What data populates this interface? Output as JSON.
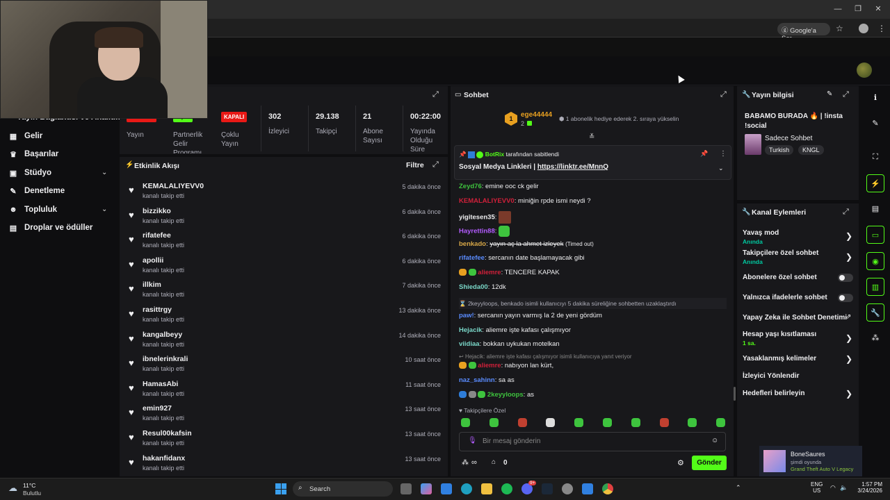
{
  "browser": {
    "google_sor": "Google'a Sor"
  },
  "stats": {
    "live_badge": "YAYINDA",
    "partner_badge": "AÇIK",
    "multi_badge": "KAPALI",
    "live_label": "Yayın",
    "partner_label": "Partnerlik Gelir Programı",
    "multi_label": "Çoklu Yayın",
    "viewers_value": "302",
    "viewers_label": "İzleyici",
    "followers_value": "29.138",
    "followers_label": "Takipçi",
    "subs_value": "21",
    "subs_label": "Abone Sayısı",
    "uptime_value": "00:22:00",
    "uptime_label": "Yayında Olduğu Süre"
  },
  "sidebar": {
    "partial_title": "Yayın Bağlantısı ve Analitik",
    "items": [
      {
        "label": "Gelir",
        "icon": "chart-icon"
      },
      {
        "label": "Başarılar",
        "icon": "trophy-icon"
      },
      {
        "label": "Stüdyo",
        "icon": "studio-icon"
      },
      {
        "label": "Denetleme",
        "icon": "wrench-icon"
      },
      {
        "label": "Topluluk",
        "icon": "community-icon"
      },
      {
        "label": "Droplar ve ödüller",
        "icon": "gift-icon"
      }
    ]
  },
  "activity": {
    "title": "Etkinlik Akışı",
    "filter": "Filtre",
    "events": [
      {
        "name": "KEMALALIYEVV0",
        "sub": "kanalı takip etti",
        "time": "5 dakika önce"
      },
      {
        "name": "bizzikko",
        "sub": "kanalı takip etti",
        "time": "6 dakika önce"
      },
      {
        "name": "rifatefee",
        "sub": "kanalı takip etti",
        "time": "6 dakika önce"
      },
      {
        "name": "apollii",
        "sub": "kanalı takip etti",
        "time": "6 dakika önce"
      },
      {
        "name": "illkim",
        "sub": "kanalı takip etti",
        "time": "7 dakika önce"
      },
      {
        "name": "rasittrgy",
        "sub": "kanalı takip etti",
        "time": "13 dakika önce"
      },
      {
        "name": "kangalbeyy",
        "sub": "kanalı takip etti",
        "time": "14 dakika önce"
      },
      {
        "name": "ibnelerinkrali",
        "sub": "kanalı takip etti",
        "time": "10 saat önce"
      },
      {
        "name": "HamasAbi",
        "sub": "kanalı takip etti",
        "time": "11 saat önce"
      },
      {
        "name": "emin927",
        "sub": "kanalı takip etti",
        "time": "13 saat önce"
      },
      {
        "name": "Resul00kafsin",
        "sub": "kanalı takip etti",
        "time": "13 saat önce"
      },
      {
        "name": "hakanfidanx",
        "sub": "kanalı takip etti",
        "time": "13 saat önce"
      }
    ]
  },
  "chat": {
    "title": "Sohbet",
    "top_gifter": "ege44444",
    "top_gifter_rank": "1",
    "top_gifter_count": "2",
    "gift_text": "1 abonelik hediye ederek 2. sıraya yükselin",
    "pin_author": "BotRix",
    "pin_by": "tarafından sabitlendi",
    "pin_text": "Sosyal Medya Linkleri | ",
    "pin_link": "https://linktr.ee/MnnQ",
    "messages": [
      {
        "user": "Zeyd76",
        "text": "emine ooc ck gelir",
        "color": "#3ec43e"
      },
      {
        "user": "KEMALALIYEVV0",
        "text": "miniğin rpde ismi neydi ?",
        "color": "#d0203a"
      },
      {
        "user": "yigitesen35",
        "text": "",
        "color": "#efeff1"
      },
      {
        "user": "Hayrettin88",
        "text": "",
        "color": "#b35cff"
      },
      {
        "user": "benkado",
        "text": "yayın aç la ahmet izleyek",
        "note": "(Timed out)",
        "color": "#d8a848"
      },
      {
        "user": "rifatefee",
        "text": "sercanın date başlamayacak gibi",
        "color": "#5a8cff"
      },
      {
        "user": "aliemre",
        "text": "TENCERE KAPAK",
        "color": "#d0203a"
      },
      {
        "user": "Shieda00",
        "text": "12dk",
        "color": "#7ad7c8"
      },
      {
        "user": "paw!",
        "text": "sercanın yayın varmış la 2 de yeni gördüm",
        "color": "#5a8cff"
      },
      {
        "user": "Hejacik",
        "text": "aliemre işte kafası çalışmıyor",
        "color": "#7ad7c8"
      },
      {
        "user": "viidiaa",
        "text": "bokkan uykukan motelkan",
        "color": "#7ad7c8"
      },
      {
        "user": "aliemre",
        "text": "nabıyon lan kürt,",
        "color": "#d0203a"
      },
      {
        "user": "naz_sahinn",
        "text": "sa as",
        "color": "#5a8cff"
      },
      {
        "user": "2keyyloops",
        "text": "as",
        "color": "#3ec43e"
      }
    ],
    "timeout_notice": "2keyyloops, benkado isimli kullanıcıyı 5 dakika süreliğine sohbetten uzaklaştırdı",
    "reply_notice": "Hejacik: aliemre işte kafası çalışmıyor isimli kullanıcıya yanıt veriyor",
    "followers_only": "Takipçilere Özel",
    "input_placeholder": "Bir mesaj gönderin",
    "points": "∞",
    "vault_count": "0",
    "send": "Gönder"
  },
  "stream_info": {
    "title": "Yayın bilgisi",
    "stream_title": "BABAMO BURADA 🔥 | !insta !social",
    "category": "Sadece Sohbet",
    "tags": [
      "Turkish",
      "KNGL"
    ]
  },
  "channel_actions": {
    "title": "Kanal Eylemleri",
    "items": [
      {
        "label": "Yavaş mod",
        "sub": "Anında",
        "control": "arrow"
      },
      {
        "label": "Takipçilere özel sohbet",
        "sub": "Anında",
        "control": "arrow"
      },
      {
        "label": "Abonelere özel sohbet",
        "sub": "",
        "control": "toggle"
      },
      {
        "label": "Yalnızca ifadelerle sohbet",
        "sub": "",
        "control": "toggle"
      },
      {
        "label": "Yapay Zeka ile Sohbet Denetimi",
        "sub": "",
        "control": "external"
      },
      {
        "label": "Hesap yaşı kısıtlaması",
        "sub": "1 sa.",
        "control": "arrow"
      },
      {
        "label": "Yasaklanmış kelimeler",
        "sub": "",
        "control": "arrow"
      },
      {
        "label": "İzleyici Yönlendir",
        "sub": "",
        "control": "none"
      },
      {
        "label": "Hedefleri belirleyin",
        "sub": "",
        "control": "arrow"
      }
    ]
  },
  "notification": {
    "user": "BoneSaures",
    "status": "şimdi oyunda",
    "game": "Grand Theft Auto V Legacy"
  },
  "taskbar": {
    "weather_temp": "11°C",
    "weather_desc": "Bulutlu",
    "search": "Search",
    "lang1": "ENG",
    "lang2": "US",
    "time": "1:57 PM",
    "date": "3/24/2026",
    "steam_badge": "9+"
  },
  "colors": {
    "accent_green": "#53fc18",
    "live_red": "#e91916",
    "panel_bg": "#18181b",
    "page_bg": "#0e0e10"
  }
}
